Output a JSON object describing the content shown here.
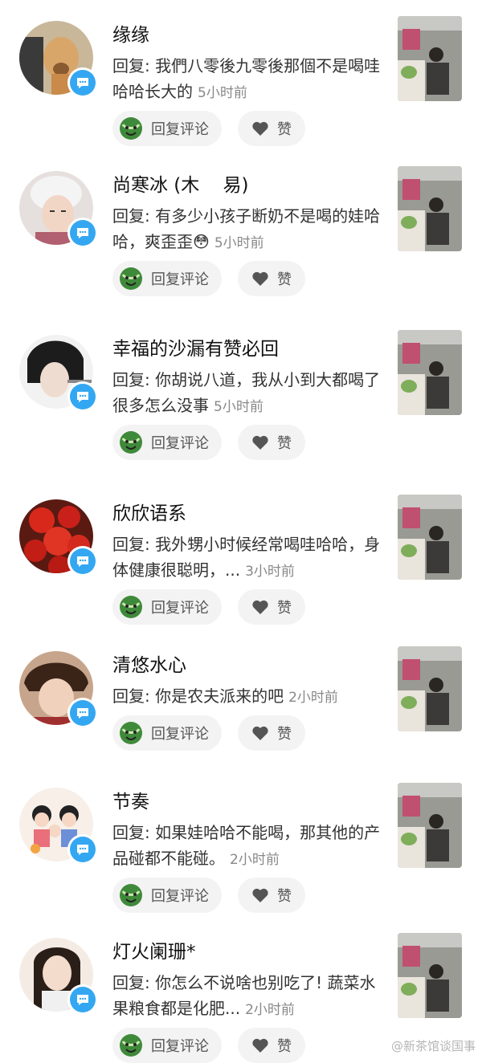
{
  "comments": [
    {
      "name": "缘缘",
      "reply": "回复: 我們八零後九零後那個不是喝哇哈哈长大的",
      "time": "5小时前"
    },
    {
      "name": "尚寒冰 (木    易)",
      "reply": "回复: 有多少小孩子断奶不是喝的娃哈哈，爽歪歪😳",
      "time": "5小时前"
    },
    {
      "name": "幸福的沙漏有赞必回",
      "reply": "回复: 你胡说八道，我从小到大都喝了很多怎么没事",
      "time": "5小时前"
    },
    {
      "name": "欣欣语系",
      "reply": "回复: 我外甥小时候经常喝哇哈哈，身体健康很聪明，...",
      "time": "3小时前"
    },
    {
      "name": "清悠水心",
      "reply": "回复: 你是农夫派来的吧",
      "time": "2小时前"
    },
    {
      "name": "节奏",
      "reply": "回复: 如果娃哈哈不能喝，那其他的产品碰都不能碰。",
      "time": "2小时前"
    },
    {
      "name": "灯火阑珊*",
      "reply": "回复: 你怎么不说啥也别吃了! 蔬菜水果粮食都是化肥...",
      "time": "2小时前"
    }
  ],
  "actions": {
    "reply_label": "回复评论",
    "like_label": "赞"
  },
  "watermark": "@新茶馆谈国事",
  "colors": {
    "badge": "#34a7f2",
    "button_bg": "#f3f3f3",
    "time": "#888888"
  },
  "icons": {
    "badge": "message-bubble-icon",
    "reply": "watermelon-emoji-icon",
    "like": "heart-icon"
  }
}
